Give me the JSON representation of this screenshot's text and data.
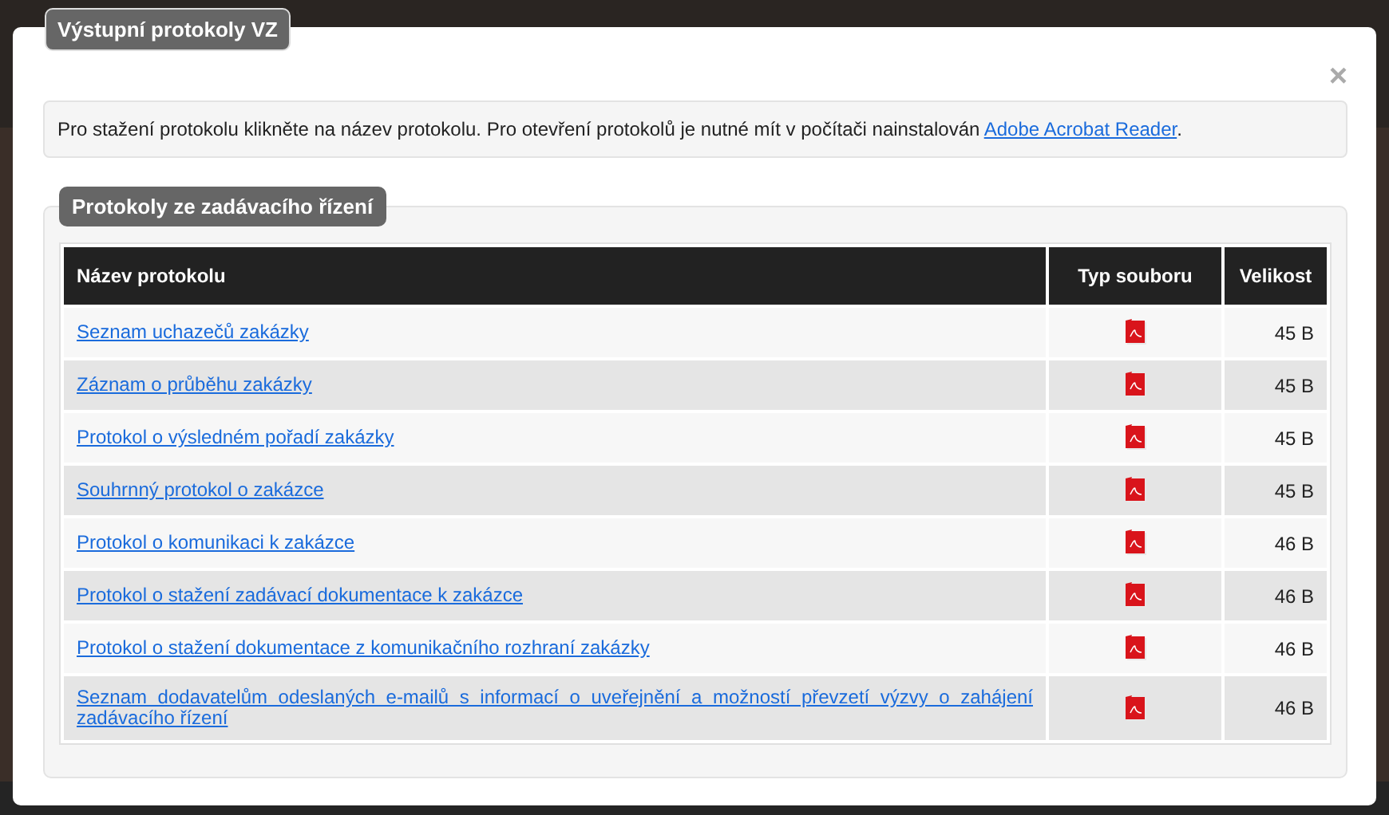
{
  "dialog": {
    "title": "Výstupní protokoly VZ",
    "close": "×"
  },
  "info": {
    "text": "Pro stažení protokolu klikněte na název protokolu. Pro otevření protokolů je nutné mít v počítači nainstalován ",
    "link": "Adobe Acrobat Reader",
    "suffix": "."
  },
  "section": {
    "title": "Protokoly ze zadávacího řízení"
  },
  "table": {
    "columns": [
      "Název protokolu",
      "Typ souboru",
      "Velikost"
    ],
    "rows": [
      {
        "name": "Seznam uchazečů zakázky",
        "kind": "pdf",
        "size": "45 B"
      },
      {
        "name": "Záznam o průběhu zakázky",
        "kind": "pdf",
        "size": "45 B"
      },
      {
        "name": "Protokol o výsledném pořadí zakázky",
        "kind": "pdf",
        "size": "45 B"
      },
      {
        "name": "Souhrnný protokol o zakázce",
        "kind": "pdf",
        "size": "45 B"
      },
      {
        "name": "Protokol o komunikaci k zakázce",
        "kind": "pdf",
        "size": "46 B"
      },
      {
        "name": "Protokol o stažení zadávací dokumentace k zakázce",
        "kind": "pdf",
        "size": "46 B"
      },
      {
        "name": "Protokol o stažení dokumentace z komunikačního rozhraní zakázky",
        "kind": "pdf",
        "size": "46 B"
      },
      {
        "name": "Seznam dodavatelům odeslaných e-mailů s informací o uveřejnění a možností převzetí výzvy o zahájení zadávacího řízení",
        "kind": "pdf",
        "size": "46 B"
      }
    ]
  }
}
